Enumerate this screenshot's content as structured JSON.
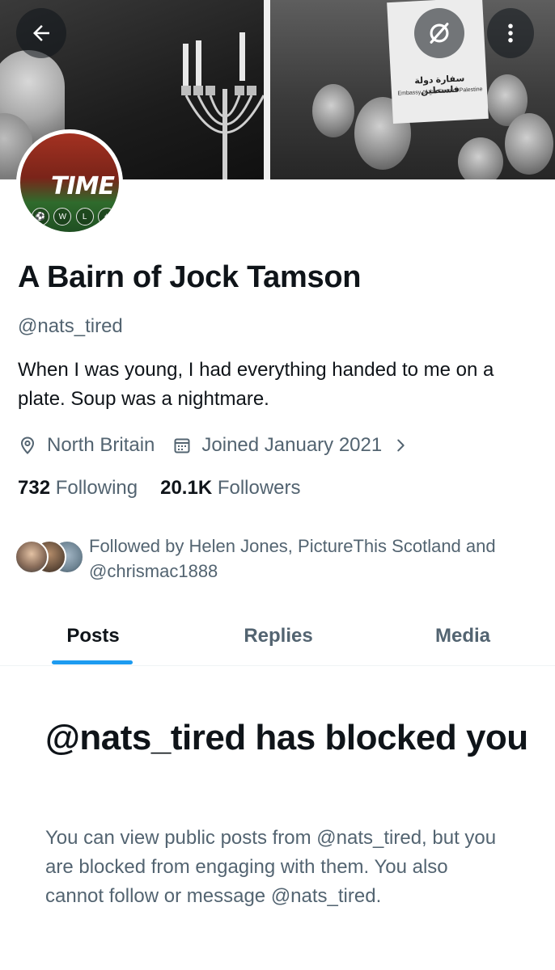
{
  "banner": {
    "sign_arabic": "سفارة دولة فلسطين",
    "sign_english": "Embassy of the State of Palestine",
    "icons": {
      "back": "arrow-left-icon",
      "relay": "relay-icon",
      "more": "more-vertical-icon"
    }
  },
  "profile": {
    "avatar_text": "TIME",
    "avatar_badges": [
      "W",
      "L"
    ],
    "display_name": "A Bairn of Jock Tamson",
    "handle": "@nats_tired",
    "bio": "When I was young, I had everything handed to me on a plate.  Soup was a nightmare.",
    "location": "North Britain",
    "joined": "Joined January 2021"
  },
  "stats": {
    "following_count": "732",
    "following_label": "Following",
    "followers_count": "20.1K",
    "followers_label": "Followers"
  },
  "followed_by": {
    "text": "Followed by Helen Jones, PictureThis Scotland and @chrismac1888"
  },
  "tabs": [
    {
      "label": "Posts",
      "active": true
    },
    {
      "label": "Replies",
      "active": false
    },
    {
      "label": "Media",
      "active": false
    }
  ],
  "blocked": {
    "title": "@nats_tired has blocked you",
    "description": "You can view public posts from @nats_tired, but you are blocked from engaging with them. You also cannot follow or message @nats_tired."
  },
  "colors": {
    "accent": "#1d9bf0",
    "text_primary": "#0f1419",
    "text_secondary": "#536471"
  }
}
